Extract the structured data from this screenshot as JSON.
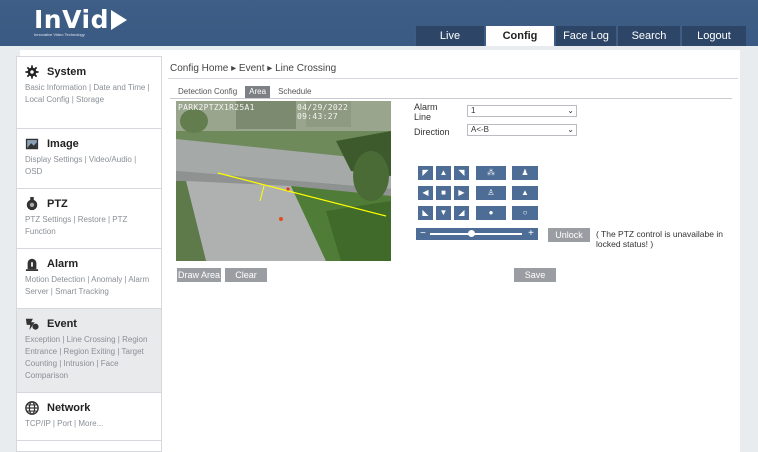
{
  "logo": {
    "brand": "InVid",
    "tagline": "Innovative Video Technology"
  },
  "nav": [
    {
      "label": "Live",
      "active": false
    },
    {
      "label": "Config",
      "active": true
    },
    {
      "label": "Face Log",
      "active": false
    },
    {
      "label": "Search",
      "active": false
    },
    {
      "label": "Logout",
      "active": false
    }
  ],
  "sidebar": [
    {
      "title": "System",
      "icon": "gear-icon",
      "links": "Basic Information | Date and Time | Local Config | Storage"
    },
    {
      "title": "Image",
      "icon": "image-icon",
      "links": "Display Settings | Video/Audio | OSD"
    },
    {
      "title": "PTZ",
      "icon": "ptz-camera-icon",
      "links": "PTZ Settings | Restore | PTZ Function"
    },
    {
      "title": "Alarm",
      "icon": "alarm-icon",
      "links": "Motion Detection | Anomaly | Alarm Server | Smart Tracking"
    },
    {
      "title": "Event",
      "icon": "event-icon",
      "links": "Exception | Line Crossing | Region Entrance | Region Exiting | Target Counting | Intrusion | Face Comparison",
      "active": true
    },
    {
      "title": "Network",
      "icon": "globe-icon",
      "links": "TCP/IP | Port | More..."
    }
  ],
  "breadcrumb": "Config Home ▸ Event ▸ Line Crossing",
  "tabs": [
    {
      "label": "Detection Config",
      "active": false
    },
    {
      "label": "Area",
      "active": true
    },
    {
      "label": "Schedule",
      "active": false
    }
  ],
  "video": {
    "osd_left": "PARK2PTZX1R25A1",
    "osd_right": "04/29/2022 09:43:27"
  },
  "buttons": {
    "draw_area": "Draw Area",
    "clear": "Clear",
    "save": "Save",
    "unlock": "Unlock"
  },
  "form": {
    "alarm_line_label": "Alarm Line",
    "alarm_line_value": "1",
    "direction_label": "Direction",
    "direction_value": "A<-B"
  },
  "ptz_note": "( The PTZ control is unavailabe in locked status!  )",
  "colors": {
    "header": "#3a5a83",
    "ptz_button": "#4d6d96",
    "gray_button": "#9a9ea3",
    "line": "#ffff00"
  }
}
